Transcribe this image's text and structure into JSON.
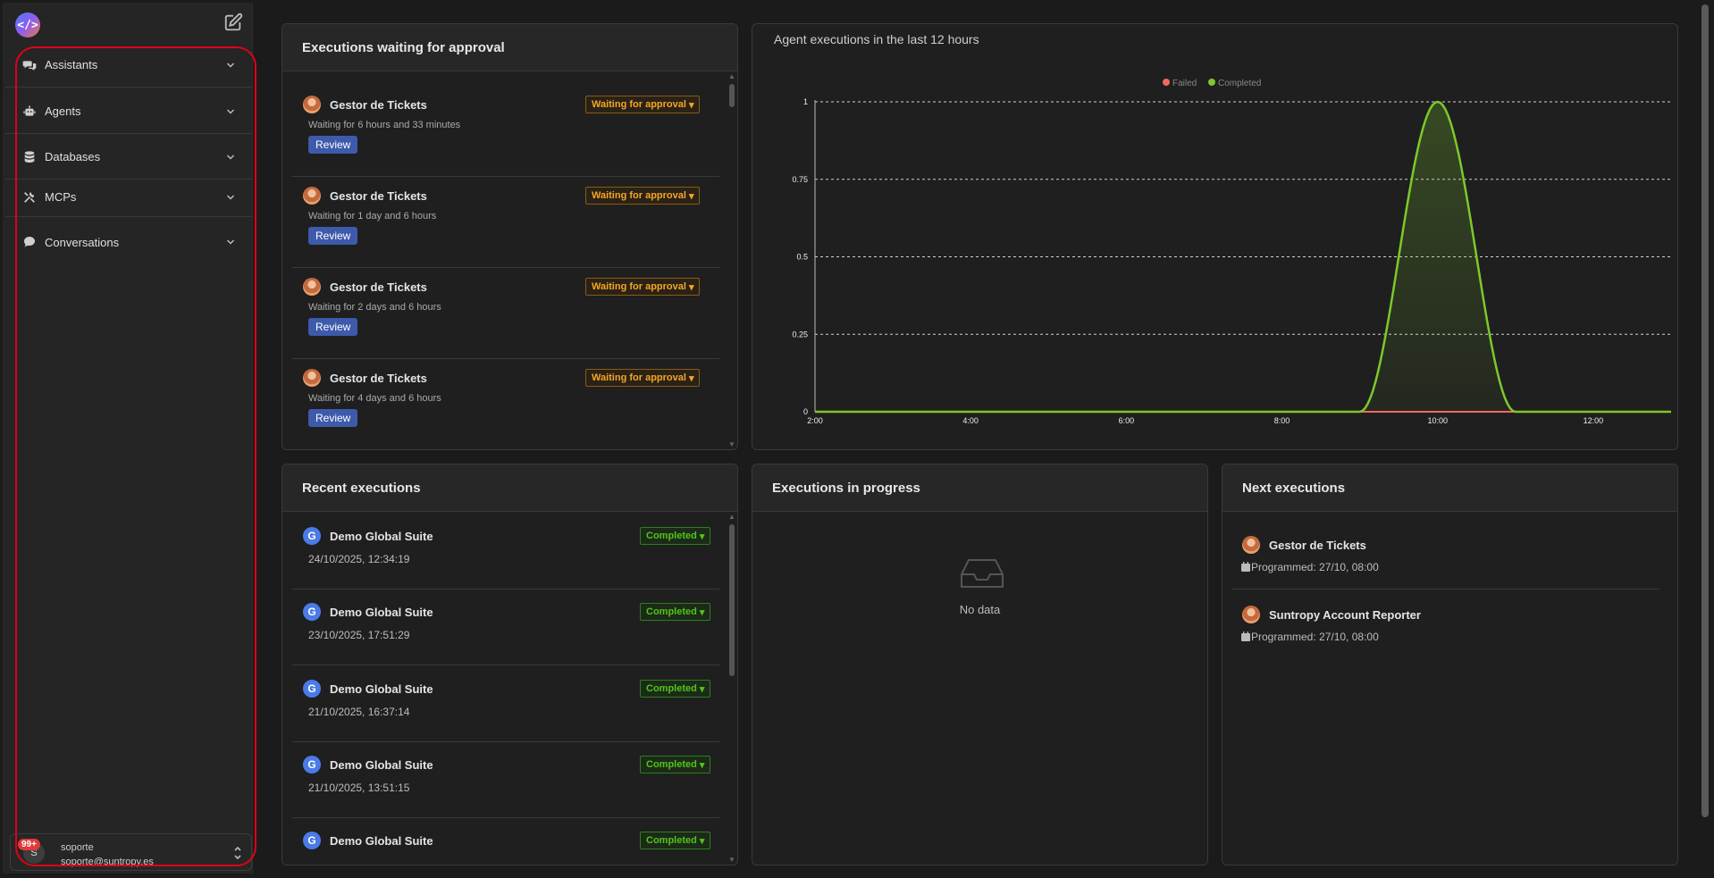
{
  "sidebar": {
    "items": [
      {
        "label": "Assistants",
        "icon": "assistants-icon"
      },
      {
        "label": "Agents",
        "icon": "robot-icon"
      },
      {
        "label": "Databases",
        "icon": "database-icon"
      },
      {
        "label": "MCPs",
        "icon": "tools-icon"
      },
      {
        "label": "Conversations",
        "icon": "chat-icon"
      }
    ],
    "user": {
      "badge": "99+",
      "initial": "S",
      "name": "soporte",
      "email": "soporte@suntropy.es"
    }
  },
  "approvals": {
    "title": "Executions waiting for approval",
    "items": [
      {
        "name": "Gestor de Tickets",
        "status": "Waiting for approval",
        "wait": "Waiting for 6 hours and 33 minutes",
        "action": "Review"
      },
      {
        "name": "Gestor de Tickets",
        "status": "Waiting for approval",
        "wait": "Waiting for 1 day and 6 hours",
        "action": "Review"
      },
      {
        "name": "Gestor de Tickets",
        "status": "Waiting for approval",
        "wait": "Waiting for 2 days and 6 hours",
        "action": "Review"
      },
      {
        "name": "Gestor de Tickets",
        "status": "Waiting for approval",
        "wait": "Waiting for 4 days and 6 hours",
        "action": "Review"
      }
    ]
  },
  "chart": {
    "title": "Agent executions in the last 12 hours",
    "colors": {
      "failed": "#f06a5e",
      "completed": "#7ec82c"
    }
  },
  "chart_data": {
    "type": "area",
    "x": [
      "2:00",
      "3:00",
      "4:00",
      "5:00",
      "6:00",
      "7:00",
      "8:00",
      "9:00",
      "10:00",
      "11:00",
      "12:00",
      "13:00"
    ],
    "series": [
      {
        "name": "Failed",
        "values": [
          0,
          0,
          0,
          0,
          0,
          0,
          0,
          0,
          0,
          0,
          0,
          0
        ]
      },
      {
        "name": "Completed",
        "values": [
          0,
          0,
          0,
          0,
          0,
          0,
          0,
          0,
          1,
          0,
          0,
          0
        ]
      }
    ],
    "xticks": [
      "2:00",
      "4:00",
      "6:00",
      "8:00",
      "10:00",
      "12:00"
    ],
    "yticks": [
      "0",
      "0.25",
      "0.5",
      "0.75",
      "1"
    ],
    "ylim": [
      0,
      1
    ],
    "grid": true,
    "legend": "top-center"
  },
  "recent": {
    "title": "Recent executions",
    "items": [
      {
        "name": "Demo Global Suite",
        "status": "Completed",
        "date": "24/10/2025, 12:34:19"
      },
      {
        "name": "Demo Global Suite",
        "status": "Completed",
        "date": "23/10/2025, 17:51:29"
      },
      {
        "name": "Demo Global Suite",
        "status": "Completed",
        "date": "21/10/2025, 16:37:14"
      },
      {
        "name": "Demo Global Suite",
        "status": "Completed",
        "date": "21/10/2025, 13:51:15"
      },
      {
        "name": "Demo Global Suite",
        "status": "Completed",
        "date": ""
      }
    ]
  },
  "progress": {
    "title": "Executions in progress",
    "empty": "No data"
  },
  "next": {
    "title": "Next executions",
    "items": [
      {
        "name": "Gestor de Tickets",
        "programmed": "Programmed: 27/10, 08:00"
      },
      {
        "name": "Suntropy Account Reporter",
        "programmed": "Programmed: 27/10, 08:00"
      }
    ]
  }
}
